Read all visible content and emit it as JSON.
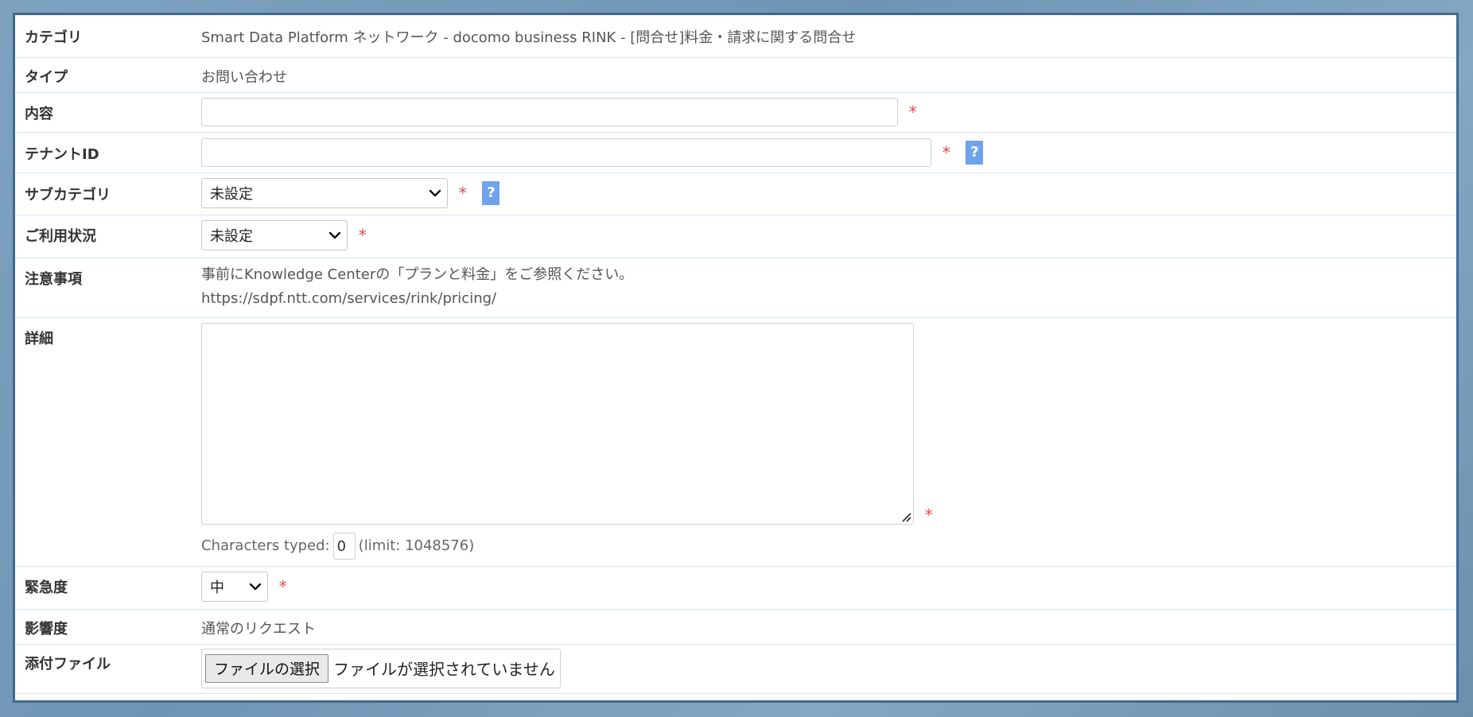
{
  "form": {
    "category": {
      "label": "カテゴリ",
      "value": "Smart Data Platform ネットワーク - docomo business RINK - [問合せ]料金・請求に関する問合せ"
    },
    "type": {
      "label": "タイプ",
      "value": "お問い合わせ"
    },
    "content": {
      "label": "内容",
      "value": "",
      "required_mark": "*"
    },
    "tenant_id": {
      "label": "テナントID",
      "value": "",
      "required_mark": "*",
      "help": "?"
    },
    "subcategory": {
      "label": "サブカテゴリ",
      "selected": "未設定",
      "required_mark": "*",
      "help": "?"
    },
    "usage_status": {
      "label": "ご利用状況",
      "selected": "未設定",
      "required_mark": "*"
    },
    "notes": {
      "label": "注意事項",
      "line1": "事前にKnowledge Centerの「プランと料金」をご参照ください。",
      "line2": "https://sdpf.ntt.com/services/rink/pricing/"
    },
    "details": {
      "label": "詳細",
      "value": "",
      "required_mark": "*",
      "counter_prefix": "Characters typed:",
      "counter_value": "0",
      "counter_limit": "(limit: 1048576)"
    },
    "urgency": {
      "label": "緊急度",
      "selected": "中",
      "required_mark": "*"
    },
    "impact": {
      "label": "影響度",
      "value": "通常のリクエスト"
    },
    "attachment": {
      "label": "添付ファイル",
      "button": "ファイルの選択",
      "status": "ファイルが選択されていません"
    }
  },
  "colors": {
    "required": "#e0484d",
    "help_badge": "#6fa3ec",
    "row_border": "#d6e6f2",
    "panel_border": "#3e6a90"
  },
  "icons": {
    "select_arrow": "chevron-down-icon",
    "textarea_resize": "resize-handle-icon"
  }
}
